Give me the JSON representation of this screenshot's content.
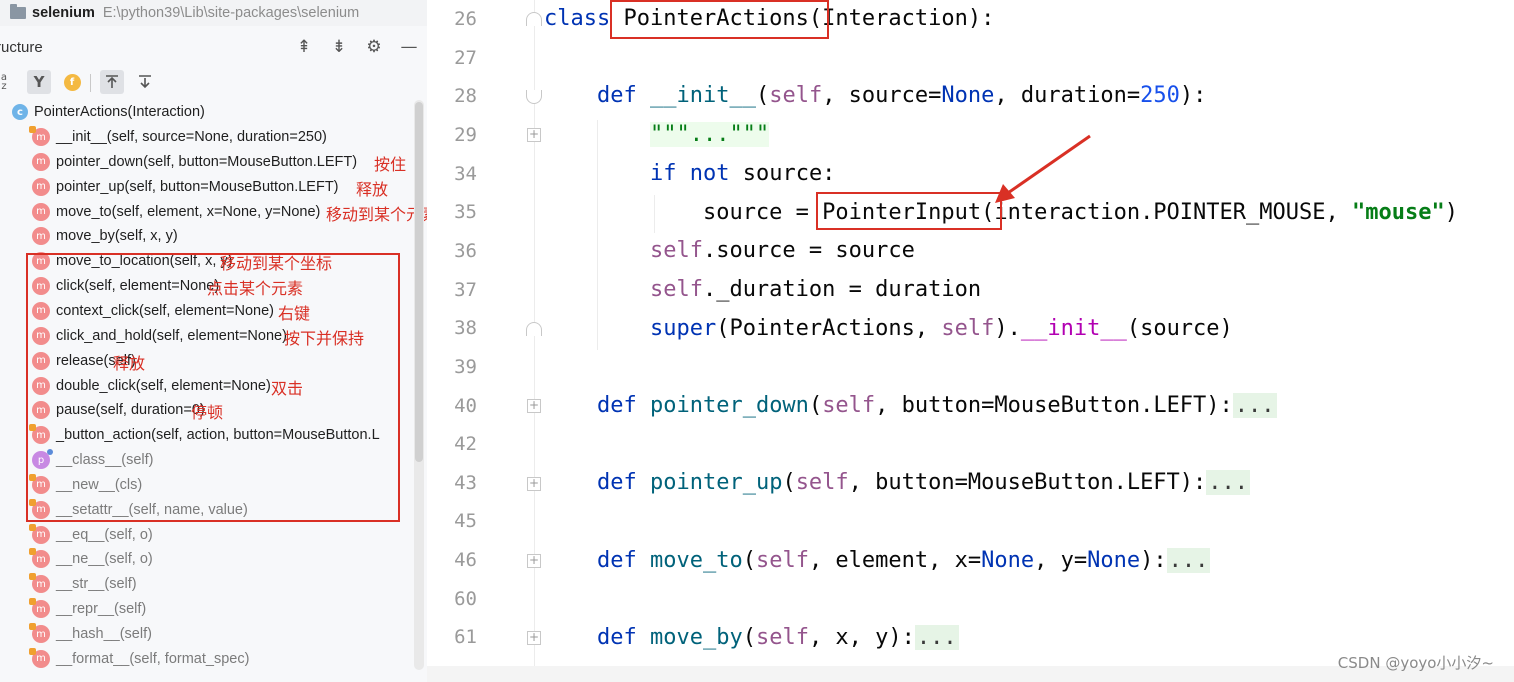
{
  "project": {
    "name": "selenium",
    "path": "E:\\python39\\Lib\\site-packages\\selenium"
  },
  "structure": {
    "title": "ructure",
    "head_tools": [
      "expand-all-icon",
      "collapse-all-icon",
      "gear-icon",
      "minimize-icon"
    ],
    "toolbar_icons": [
      "sort-alpha-icon",
      "visibility-filter-icon",
      "show-fields-icon",
      "autoscroll-to-source-icon",
      "autoscroll-from-source-icon"
    ],
    "sort_glyph": "a\nz",
    "visibility_glyph": "Y",
    "fields_glyph": "f",
    "class_icon": "c",
    "method_icon": "m",
    "property_icon": "p",
    "class_item": "PointerActions(Interaction)",
    "items": [
      {
        "text": "__init__(self, source=None, duration=250)",
        "note": ""
      },
      {
        "text": "pointer_down(self, button=MouseButton.LEFT)",
        "note": "按住"
      },
      {
        "text": "pointer_up(self, button=MouseButton.LEFT)",
        "note": "释放"
      },
      {
        "text": "move_to(self, element, x=None, y=None)",
        "note": "移动到某个元素或坐标"
      },
      {
        "text": "move_by(self, x, y)",
        "note": ""
      },
      {
        "text": "move_to_location(self, x, y)",
        "note": "移动到某个坐标"
      },
      {
        "text": "click(self, element=None)",
        "note": "点击某个元素"
      },
      {
        "text": "context_click(self, element=None)",
        "note": "右键"
      },
      {
        "text": "click_and_hold(self, element=None)",
        "note": "按下并保持"
      },
      {
        "text": "release(self)",
        "note": "释放"
      },
      {
        "text": "double_click(self, element=None)",
        "note": "双击"
      },
      {
        "text": "pause(self, duration=0)",
        "note": "停顿"
      },
      {
        "text": "_button_action(self, action, button=MouseButton.L",
        "note": ""
      },
      {
        "text": "__class__(self)",
        "note": ""
      },
      {
        "text": "__new__(cls)",
        "note": ""
      },
      {
        "text": "__setattr__(self, name, value)",
        "note": ""
      },
      {
        "text": "__eq__(self, o)",
        "note": ""
      },
      {
        "text": "__ne__(self, o)",
        "note": ""
      },
      {
        "text": "__str__(self)",
        "note": ""
      },
      {
        "text": "__repr__(self)",
        "note": ""
      },
      {
        "text": "__hash__(self)",
        "note": ""
      },
      {
        "text": "__format__(self, format_spec)",
        "note": ""
      }
    ]
  },
  "editor": {
    "line_numbers": [
      "26",
      "27",
      "28",
      "29",
      "34",
      "35",
      "36",
      "37",
      "38",
      "39",
      "40",
      "42",
      "43",
      "45",
      "46",
      "60",
      "61"
    ],
    "fold_glyph": "+",
    "tokens": {
      "l26_kw": "class",
      "l26_name": "PointerActions",
      "l26_rest": "(Interaction):",
      "l28_def": "def",
      "l28_fn": "__init__",
      "l28_open": "(",
      "l28_self": "self",
      "l28_mid": ", source=",
      "l28_none": "None",
      "l28_mid2": ", duration=",
      "l28_num": "250",
      "l28_end": "):",
      "l29_doc": "\"\"\"...\"\"\"",
      "l34_if": "if",
      "l34_not": "not",
      "l34_rest": " source:",
      "l35_a": "source = ",
      "l35_b": "PointerInput",
      "l35_c": "(interaction.POINTER_MOUSE, ",
      "l35_str": "\"mouse\"",
      "l35_end": ")",
      "l36_self": "self",
      "l36_rest": ".source = source",
      "l37_self": "self",
      "l37_rest": "._duration = duration",
      "l38_super": "super",
      "l38_a": "(PointerActions, ",
      "l38_self": "self",
      "l38_b": ").",
      "l38_init": "__init__",
      "l38_c": "(source)",
      "l40_def": "def",
      "l40_fn": "pointer_down",
      "l40_open": "(",
      "l40_self": "self",
      "l40_rest": ", button=MouseButton.LEFT):",
      "l43_def": "def",
      "l43_fn": "pointer_up",
      "l43_open": "(",
      "l43_self": "self",
      "l43_rest": ", button=MouseButton.LEFT):",
      "l46_def": "def",
      "l46_fn": "move_to",
      "l46_open": "(",
      "l46_self": "self",
      "l46_a": ", element, x=",
      "l46_none1": "None",
      "l46_b": ", y=",
      "l46_none2": "None",
      "l46_c": "):",
      "l61_def": "def",
      "l61_fn": "move_by",
      "l61_open": "(",
      "l61_self": "self",
      "l61_rest": ", x, y):",
      "fold_placeholder": "..."
    }
  },
  "watermark": "CSDN @yoyo小小汐~",
  "colors": {
    "annotation_red": "#d93025",
    "keyword": "#0033b3",
    "function": "#00627a",
    "self": "#94558d",
    "number": "#1750eb",
    "string": "#067d17"
  }
}
